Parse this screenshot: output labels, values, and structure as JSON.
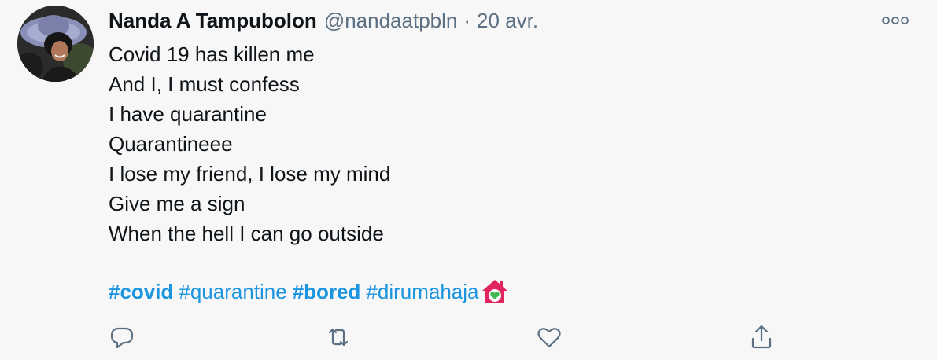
{
  "tweet": {
    "author_name": "Nanda A Tampubolon",
    "author_handle": "@nandaatpbln",
    "separator": "·",
    "date": "20 avr.",
    "lines": [
      "Covid 19 has killen me",
      "And I, I must confess",
      "I have quarantine",
      "Quarantineee",
      "I lose my friend, I lose my mind",
      "Give me a sign",
      "When the hell I can go outside"
    ],
    "hashtags": [
      {
        "text": "#covid",
        "bold": true
      },
      {
        "text": "#quarantine",
        "bold": false
      },
      {
        "text": "#bored",
        "bold": true
      },
      {
        "text": "#dirumahaja",
        "bold": false
      }
    ],
    "emoji_icon": "house-with-heart-icon"
  },
  "actions": {
    "reply_icon": "reply-icon",
    "retweet_icon": "retweet-icon",
    "like_icon": "heart-icon",
    "share_icon": "share-icon",
    "more_icon": "more-options-icon"
  },
  "colors": {
    "background": "#f7f7f7",
    "text": "#0f1419",
    "secondary": "#5b7083",
    "hashtag": "#1b95e0",
    "house_emoji": "#e0245e"
  }
}
